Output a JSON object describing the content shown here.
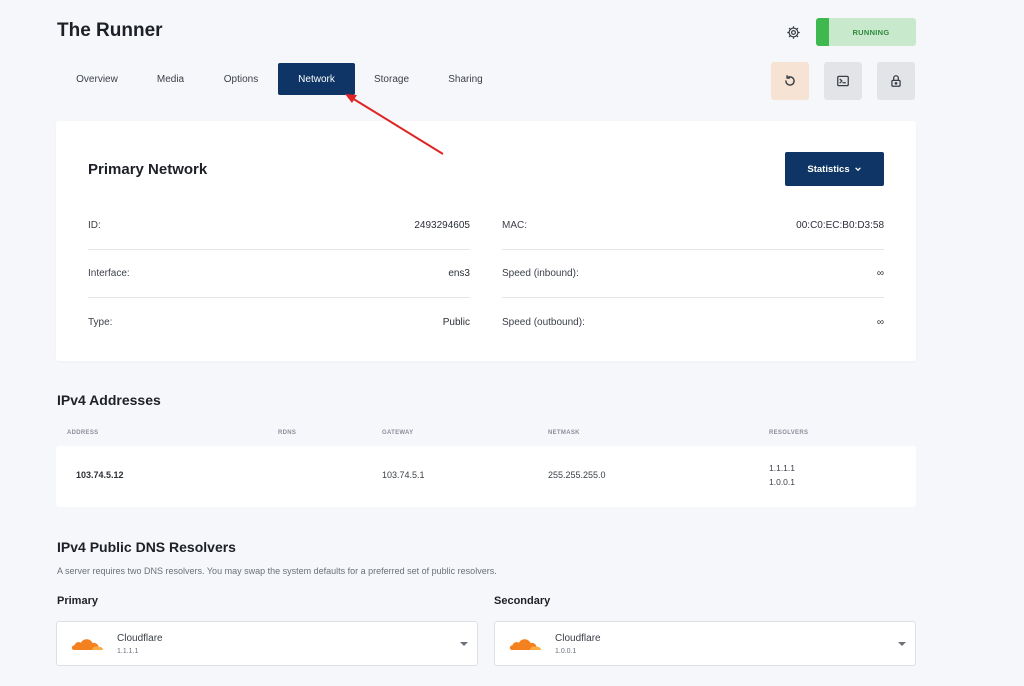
{
  "header": {
    "title": "The Runner",
    "status": "RUNNING",
    "colors": {
      "accent": "#0e3565",
      "status_bg": "#c9e9cc",
      "status_bar": "#3fb850"
    }
  },
  "tabs": [
    {
      "label": "Overview",
      "active": false
    },
    {
      "label": "Media",
      "active": false
    },
    {
      "label": "Options",
      "active": false
    },
    {
      "label": "Network",
      "active": true
    },
    {
      "label": "Storage",
      "active": false
    },
    {
      "label": "Sharing",
      "active": false
    }
  ],
  "actions": {
    "restart_icon": "restart-icon",
    "console_icon": "terminal-icon",
    "lock_icon": "lock-icon",
    "settings_icon": "gear-icon"
  },
  "network": {
    "title": "Primary Network",
    "statistics_label": "Statistics",
    "left": [
      {
        "label": "ID:",
        "value": "2493294605"
      },
      {
        "label": "Interface:",
        "value": "ens3"
      },
      {
        "label": "Type:",
        "value": "Public"
      }
    ],
    "right": [
      {
        "label": "MAC:",
        "value": "00:C0:EC:B0:D3:58"
      },
      {
        "label": "Speed (inbound):",
        "value": "∞"
      },
      {
        "label": "Speed (outbound):",
        "value": "∞"
      }
    ]
  },
  "ipv4": {
    "title": "IPv4 Addresses",
    "columns": [
      "ADDRESS",
      "RDNS",
      "GATEWAY",
      "NETMASK",
      "RESOLVERS"
    ],
    "rows": [
      {
        "address": "103.74.5.12",
        "rdns": "",
        "gateway": "103.74.5.1",
        "netmask": "255.255.255.0",
        "resolvers": [
          "1.1.1.1",
          "1.0.0.1"
        ]
      }
    ]
  },
  "dns": {
    "title": "IPv4 Public DNS Resolvers",
    "description": "A server requires two DNS resolvers. You may swap the system defaults for a preferred set of public resolvers.",
    "primary": {
      "label": "Primary",
      "provider": "Cloudflare",
      "ip": "1.1.1.1"
    },
    "secondary": {
      "label": "Secondary",
      "provider": "Cloudflare",
      "ip": "1.0.0.1"
    }
  }
}
